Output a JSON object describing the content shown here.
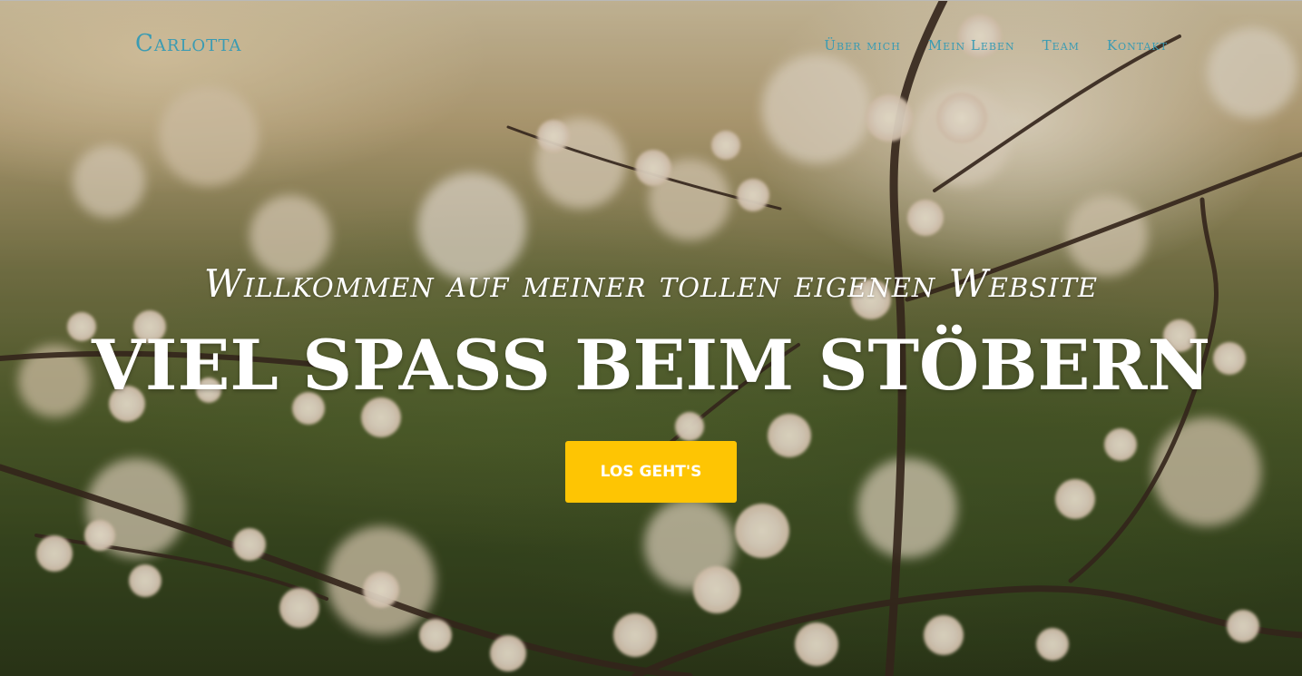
{
  "brand": {
    "name": "Carlotta"
  },
  "nav": {
    "items": [
      {
        "label": "Über mich"
      },
      {
        "label": "Mein Leben"
      },
      {
        "label": "Team"
      },
      {
        "label": "Kontakt"
      }
    ]
  },
  "hero": {
    "subheading": "Willkommen auf meiner tollen eigenen Website",
    "heading": "VIEL SPASS BEIM STÖBERN",
    "cta_label": "LOS GEHT'S",
    "background_image": "blossoming-branches-photo"
  },
  "colors": {
    "accent": "#3a9bb3",
    "cta": "#fec503",
    "hero_text": "#ffffff"
  }
}
